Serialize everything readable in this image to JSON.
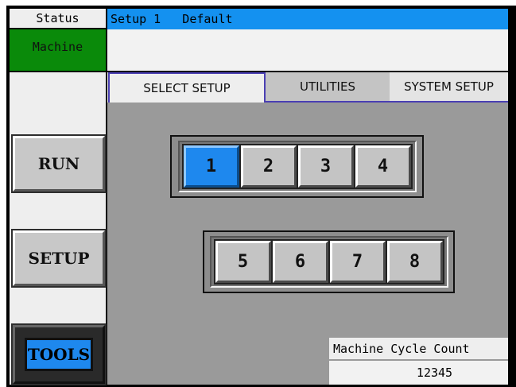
{
  "status": {
    "label": "Status",
    "badge": "Machine"
  },
  "header": {
    "setup_bar": "Setup 1   Default"
  },
  "sidebar": {
    "run_label": "RUN",
    "setup_label": "SETUP",
    "tools_label": "TOOLS",
    "active_item": "TOOLS"
  },
  "tabs": [
    {
      "label": "SELECT SETUP",
      "active": true
    },
    {
      "label": "UTILITIES",
      "active": false
    },
    {
      "label": "SYSTEM SETUP",
      "active": false
    }
  ],
  "setup_buttons": {
    "row1": [
      "1",
      "2",
      "3",
      "4"
    ],
    "row2": [
      "5",
      "6",
      "7",
      "8"
    ],
    "selected": "1"
  },
  "cycle": {
    "label": "Machine Cycle Count",
    "value": "12345"
  },
  "colors": {
    "accent_blue": "#1491f0",
    "status_green": "#0a8a0a",
    "panel_gray": "#9a9a9a",
    "tab_border": "#4a3fb3"
  }
}
